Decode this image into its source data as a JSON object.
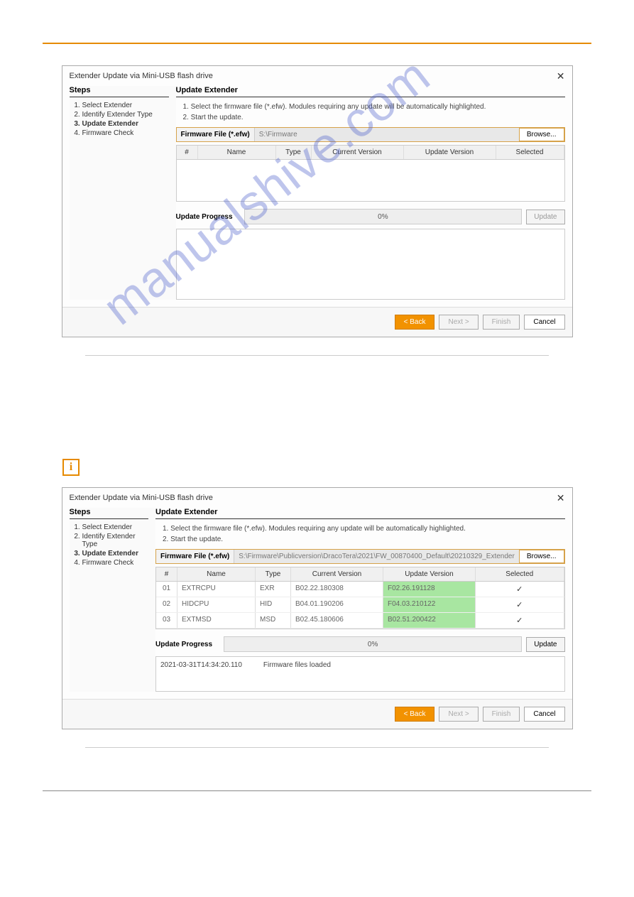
{
  "watermark": "manualshive.com",
  "dialog1": {
    "title": "Extender Update via Mini-USB flash drive",
    "steps_heading": "Steps",
    "steps": [
      "Select Extender",
      "Identify Extender Type",
      "Update Extender",
      "Firmware Check"
    ],
    "active_step_index": 2,
    "main_heading": "Update Extender",
    "instructions": [
      "1.   Select the firmware file (*.efw). Modules requiring any update will be automatically highlighted.",
      "2.   Start the update."
    ],
    "ff_label": "Firmware File (*.efw)",
    "ff_value": "S:\\Firmware",
    "browse": "Browse...",
    "grid_headers": {
      "num": "#",
      "name": "Name",
      "type": "Type",
      "cur": "Current Version",
      "upd": "Update Version",
      "sel": "Selected"
    },
    "progress_label": "Update Progress",
    "progress_text": "0%",
    "update_btn": "Update",
    "buttons": {
      "back": "< Back",
      "next": "Next >",
      "finish": "Finish",
      "cancel": "Cancel"
    }
  },
  "dialog2": {
    "title": "Extender Update via Mini-USB flash drive",
    "steps_heading": "Steps",
    "steps": [
      "Select Extender",
      "Identify Extender Type",
      "Update Extender",
      "Firmware Check"
    ],
    "active_step_index": 2,
    "main_heading": "Update Extender",
    "instructions": [
      "1.   Select the firmware file (*.efw). Modules requiring any update will be automatically highlighted.",
      "2.   Start the update."
    ],
    "ff_label": "Firmware File (*.efw)",
    "ff_value": "S:\\Firmware\\Publicversion\\DracoTera\\2021\\FW_00870400_Default\\20210329_Extender",
    "browse": "Browse...",
    "grid_headers": {
      "num": "#",
      "name": "Name",
      "type": "Type",
      "cur": "Current Version",
      "upd": "Update Version",
      "sel": "Selected"
    },
    "rows": [
      {
        "num": "01",
        "name": "EXTRCPU",
        "type": "EXR",
        "cur": "B02.22.180308",
        "upd": "F02.26.191128",
        "sel": true
      },
      {
        "num": "02",
        "name": "HIDCPU",
        "type": "HID",
        "cur": "B04.01.190206",
        "upd": "F04.03.210122",
        "sel": true
      },
      {
        "num": "03",
        "name": "EXTMSD",
        "type": "MSD",
        "cur": "B02.45.180606",
        "upd": "B02.51.200422",
        "sel": true
      }
    ],
    "progress_label": "Update Progress",
    "progress_text": "0%",
    "update_btn": "Update",
    "log": {
      "ts": "2021-03-31T14:34:20.110",
      "msg": "Firmware files loaded"
    },
    "buttons": {
      "back": "< Back",
      "next": "Next >",
      "finish": "Finish",
      "cancel": "Cancel"
    }
  }
}
